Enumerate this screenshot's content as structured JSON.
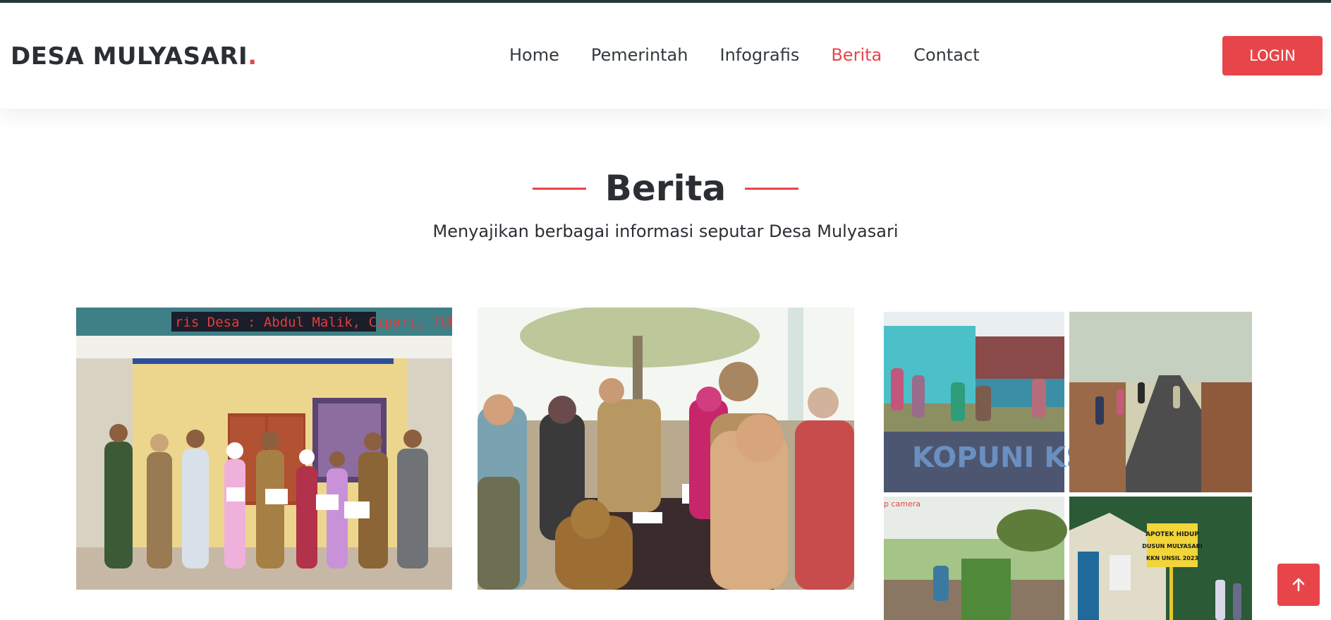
{
  "brand": {
    "name": "DESA MULYASARI",
    "dot": "."
  },
  "nav": {
    "items": [
      {
        "label": "Home"
      },
      {
        "label": "Pemerintah"
      },
      {
        "label": "Infografis"
      },
      {
        "label": "Berita"
      },
      {
        "label": "Contact"
      }
    ],
    "active": "Berita"
  },
  "login_label": "LOGIN",
  "section": {
    "title": "Berita",
    "subtitle": "Menyajikan berbagai informasi seputar Desa Mulyasari"
  },
  "cards": {
    "photo1": {
      "sign_text": "ris Desa : Abdul Malik, Cipari, TUM"
    },
    "collage": {
      "caption": "p camera",
      "sign_lines": [
        "APOTEK HIDUP",
        "DUSUN MULYASARI",
        "KKN UNSIL 2023"
      ]
    }
  },
  "icons": {
    "scroll_top": "arrow-up-icon"
  },
  "colors": {
    "accent": "#e8454a",
    "dark": "#2b2f33",
    "topbar": "#243a3a"
  }
}
